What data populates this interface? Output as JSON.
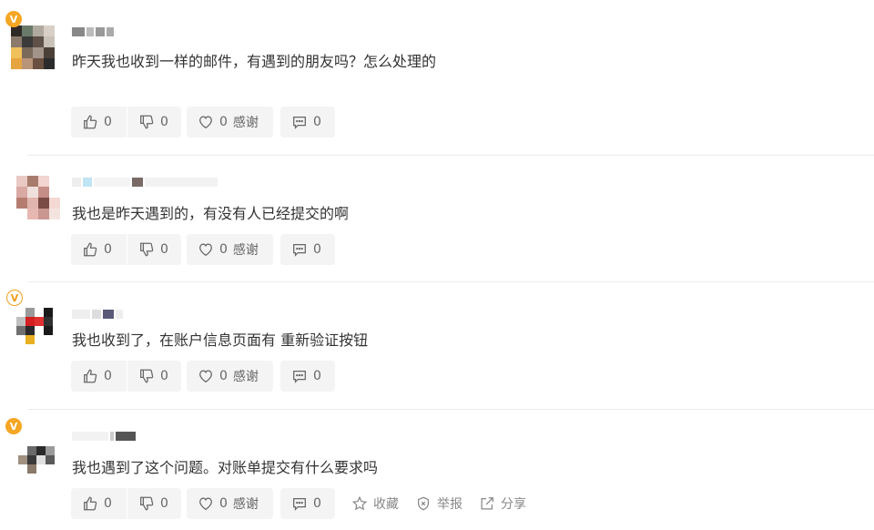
{
  "comments": [
    {
      "text": "昨天我也收到一样的邮件，有遇到的朋友吗？怎么处理的",
      "username": "王月",
      "badge": "V",
      "avatar_colors": [
        "#2f2a25",
        "#6a7a6a",
        "#b0a9a0",
        "#d8d0c8",
        "#8c7b6c",
        "#3b3b3b",
        "#5e5148",
        "#c9c2b9",
        "#f0c15a",
        "#7a6a5a",
        "#a3948a",
        "#4a4038",
        "#e6a540",
        "#b89478",
        "#6a5040",
        "#2c2c2c"
      ],
      "likes": "0",
      "dislikes": "0",
      "thanks": "0",
      "thanks_label": "感谢",
      "replies": "0"
    },
    {
      "text": "我也是昨天遇到的，有没有人已经提交的啊",
      "username": "",
      "badge": "",
      "avatar_colors": [
        "#e9c9c4",
        "#a87c6c",
        "#f2d4d0",
        "#ffffff",
        "#d9a9a4",
        "#f0e0dc",
        "#c58e87",
        "#ffffff",
        "#b57d70",
        "#e0b5ae",
        "#7a4a44",
        "#f4d8d4",
        "#ffffff",
        "#e7b8b2",
        "#c99690",
        "#f4e4e0"
      ],
      "likes": "0",
      "dislikes": "0",
      "thanks": "0",
      "thanks_label": "感谢",
      "replies": "0"
    },
    {
      "text": "我也收到了，在账户信息页面有 重新验证按钮",
      "username": "",
      "badge": "V",
      "avatar_colors": [
        "#ffffff",
        "#9a9a9a",
        "#ffffff",
        "#1a1a1a",
        "#c0c0c0",
        "#d42020",
        "#e03030",
        "#303030",
        "#707070",
        "#2a2a2a",
        "#ffffff",
        "#1a1a1a",
        "#ffffff",
        "#e8b020",
        "#ffffff",
        "#ffffff"
      ],
      "likes": "0",
      "dislikes": "0",
      "thanks": "0",
      "thanks_label": "感谢",
      "replies": "0"
    },
    {
      "text": "我也遇到了这个问题。对账单提交有什么要求吗",
      "username": "",
      "badge": "V",
      "avatar_colors": [
        "#ffffff",
        "#ffffff",
        "#ffffff",
        "#ffffff",
        "#ffffff",
        "#6a6a6a",
        "#2a2a2a",
        "#9a9a9a",
        "#a09080",
        "#3a3a3a",
        "#e0e0e0",
        "#5a5a5a",
        "#ffffff",
        "#8a7a6a",
        "#ffffff",
        "#ffffff"
      ],
      "likes": "0",
      "dislikes": "0",
      "thanks": "0",
      "thanks_label": "感谢",
      "replies": "0",
      "extra": {
        "favorite": "收藏",
        "report": "举报",
        "share": "分享"
      }
    }
  ],
  "colors": {
    "button_bg": "#f4f4f4",
    "text": "#333333",
    "muted": "#666666",
    "badge": "#f5a623"
  }
}
